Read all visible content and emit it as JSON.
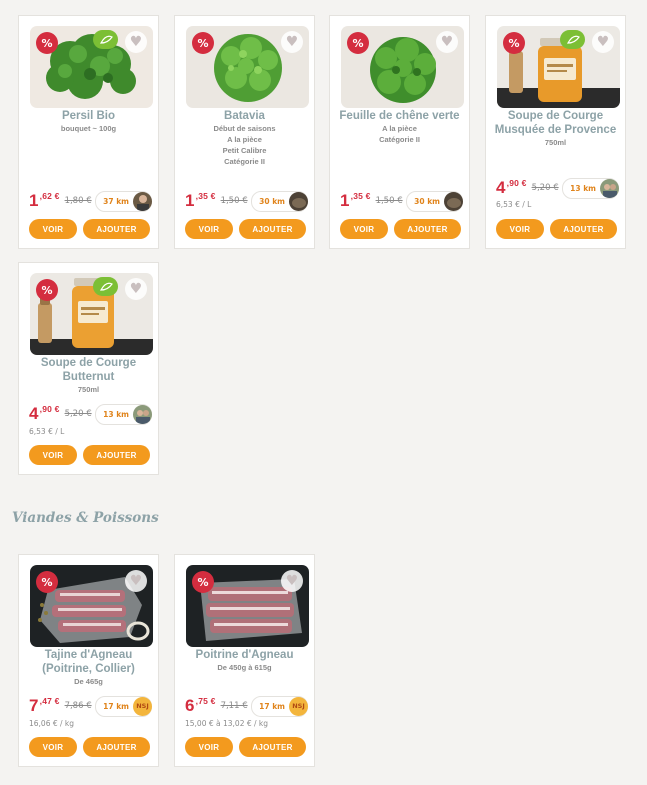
{
  "sections": [
    {
      "title": "",
      "products": [
        {
          "name": "Persil Bio",
          "details": [
            "bouquet ~ 100g"
          ],
          "price_main": "1",
          "price_cents": ",62 €",
          "old_price": "1,80 €",
          "distance": "37 km",
          "unit_price": "",
          "badges": {
            "promo": "%",
            "bio": true
          },
          "image": "persil"
        },
        {
          "name": "Batavia",
          "details": [
            "Début de saisons",
            "A la pièce",
            "Petit Calibre",
            "Catégorie II"
          ],
          "price_main": "1",
          "price_cents": ",35 €",
          "old_price": "1,50 €",
          "distance": "30 km",
          "unit_price": "",
          "badges": {
            "promo": "%",
            "bio": false
          },
          "image": "salad"
        },
        {
          "name": "Feuille de chêne verte",
          "details": [
            "A la pièce",
            "Catégorie II"
          ],
          "price_main": "1",
          "price_cents": ",35 €",
          "old_price": "1,50 €",
          "distance": "30 km",
          "unit_price": "",
          "badges": {
            "promo": "%",
            "bio": false
          },
          "image": "salad"
        },
        {
          "name": "Soupe de Courge Musquée de Provence",
          "details": [
            "750ml"
          ],
          "price_main": "4",
          "price_cents": ",90 €",
          "old_price": "5,20 €",
          "distance": "13 km",
          "unit_price": "6,53 € / L",
          "badges": {
            "promo": "%",
            "bio": true
          },
          "image": "jar"
        },
        {
          "name": "Soupe de Courge Butternut",
          "details": [
            "750ml"
          ],
          "price_main": "4",
          "price_cents": ",90 €",
          "old_price": "5,20 €",
          "distance": "13 km",
          "unit_price": "6,53 € / L",
          "badges": {
            "promo": "%",
            "bio": true
          },
          "image": "jar"
        }
      ]
    },
    {
      "title": "Viandes & Poissons",
      "products": [
        {
          "name": "Tajine d'Agneau (Poitrine, Collier)",
          "details": [
            "De 465g"
          ],
          "price_main": "7",
          "price_cents": ",47 €",
          "old_price": "7,86 €",
          "distance": "17 km",
          "unit_price": "16,06 € / kg",
          "badges": {
            "promo": "%",
            "bio": false
          },
          "image": "meat",
          "producer_logo": "NSJ"
        },
        {
          "name": "Poitrine d'Agneau",
          "details": [
            "De 450g à 615g"
          ],
          "price_main": "6",
          "price_cents": ",75 €",
          "old_price": "7,11 €",
          "distance": "17 km",
          "unit_price": "15,00 € à 13,02 € / kg",
          "badges": {
            "promo": "%",
            "bio": false
          },
          "image": "meat",
          "producer_logo": "NSJ"
        }
      ]
    }
  ],
  "buttons": {
    "view": "VOIR",
    "add": "AJOUTER"
  },
  "icons": {
    "promo": "percent-badge-icon",
    "bio": "eu-organic-leaf-icon",
    "favorite": "heart-icon"
  },
  "colors": {
    "price": "#d42d3f",
    "button": "#f39a1e",
    "title": "#8da2a7",
    "bio": "#7cbf35",
    "distance": "#e0841c"
  }
}
